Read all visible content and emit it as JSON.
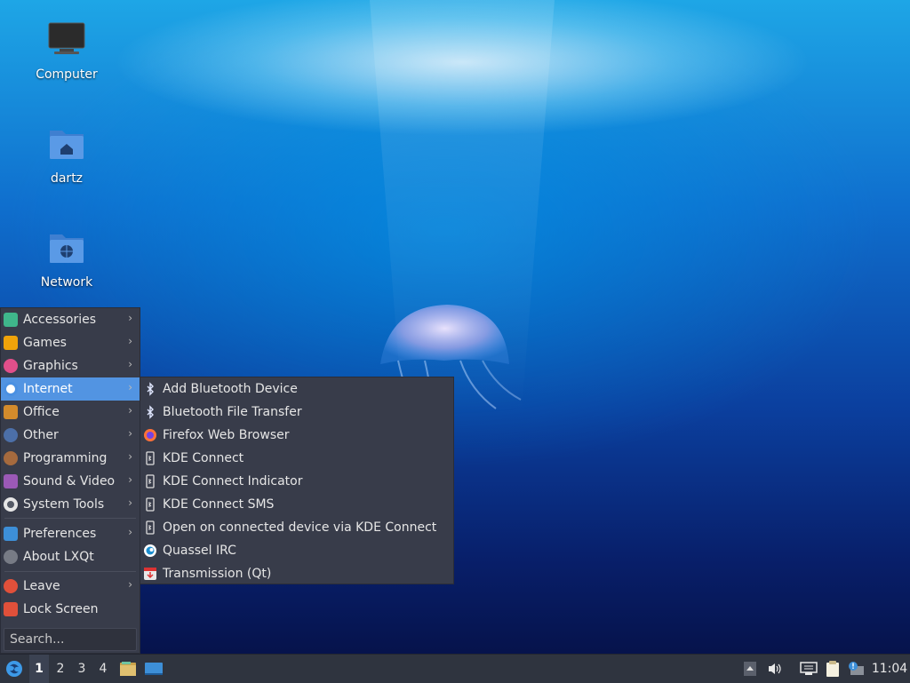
{
  "desktop": {
    "icons": [
      {
        "label": "Computer"
      },
      {
        "label": "dartz"
      },
      {
        "label": "Network"
      }
    ]
  },
  "menu": {
    "items": [
      {
        "label": "Accessories",
        "icon": "accessories-icon",
        "color": "#3fb68b"
      },
      {
        "label": "Games",
        "icon": "games-icon",
        "color": "#f0a30a"
      },
      {
        "label": "Graphics",
        "icon": "graphics-icon",
        "color": "#e14f8a"
      },
      {
        "label": "Internet",
        "icon": "internet-icon",
        "color": "#4a90e2"
      },
      {
        "label": "Office",
        "icon": "office-icon",
        "color": "#d38b2c"
      },
      {
        "label": "Other",
        "icon": "other-icon",
        "color": "#4c6fa8"
      },
      {
        "label": "Programming",
        "icon": "programming-icon",
        "color": "#a56a3e"
      },
      {
        "label": "Sound & Video",
        "icon": "sound-video-icon",
        "color": "#9b59b6"
      },
      {
        "label": "System Tools",
        "icon": "system-tools-icon",
        "color": "#555a66"
      },
      {
        "label": "Preferences",
        "icon": "preferences-icon",
        "color": "#3d8fd8"
      },
      {
        "label": "About LXQt",
        "icon": "info-icon",
        "color": "#777b85"
      },
      {
        "label": "Leave",
        "icon": "power-icon",
        "color": "#e0503a"
      },
      {
        "label": "Lock Screen",
        "icon": "lock-icon",
        "color": "#e0503a"
      }
    ],
    "search_placeholder": "Search..."
  },
  "submenu": {
    "items": [
      {
        "label": "Add Bluetooth Device",
        "icon": "bluetooth-icon"
      },
      {
        "label": "Bluetooth File Transfer",
        "icon": "bluetooth-icon"
      },
      {
        "label": "Firefox Web Browser",
        "icon": "firefox-icon"
      },
      {
        "label": "KDE Connect",
        "icon": "kdeconnect-icon"
      },
      {
        "label": "KDE Connect Indicator",
        "icon": "kdeconnect-icon"
      },
      {
        "label": "KDE Connect SMS",
        "icon": "kdeconnect-icon"
      },
      {
        "label": "Open on connected device via KDE Connect",
        "icon": "kdeconnect-icon"
      },
      {
        "label": "Quassel IRC",
        "icon": "quassel-icon"
      },
      {
        "label": "Transmission (Qt)",
        "icon": "transmission-icon"
      }
    ]
  },
  "taskbar": {
    "desktops": [
      "1",
      "2",
      "3",
      "4"
    ],
    "active_desktop": "1",
    "clock": "11:04"
  },
  "theme": {
    "menu_bg": "#383c4a",
    "highlight": "#5294e2",
    "taskbar_bg": "#2f343f"
  }
}
